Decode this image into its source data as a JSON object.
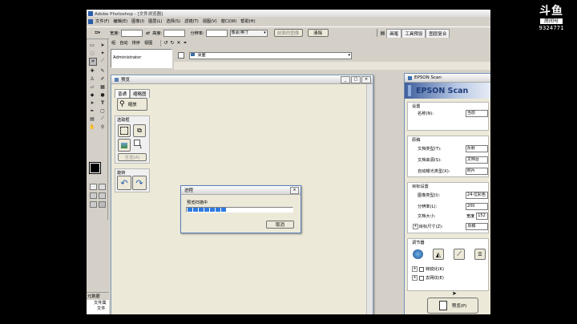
{
  "app": {
    "title": "Adobe Photoshop - [文件浏览器]"
  },
  "menu": [
    "文件(F)",
    "编辑(E)",
    "图像(I)",
    "图层(L)",
    "选择(S)",
    "滤镜(T)",
    "视图(V)",
    "窗口(W)",
    "帮助(H)"
  ],
  "options_bar": {
    "feather_label": "宽度:",
    "height_label": "高度:",
    "resolution_label": "分辨率:",
    "unit_value": "像素/英寸",
    "front_image_label": "前面的图像",
    "clear_label": "清除"
  },
  "palette_well": {
    "tabs": [
      "画笔",
      "工具预设",
      "图层复合"
    ]
  },
  "file_browser": {
    "menu": [
      "组",
      "自动",
      "排序",
      "视图"
    ],
    "folder_item": "Administrator",
    "location_value": "桌面"
  },
  "preview_window": {
    "title": "预览",
    "tabs": [
      "普通",
      "缩略图"
    ],
    "zoom_label": "缩放",
    "select_frame_label": "选取框",
    "select_all_label": "全选(A)",
    "rotate_label": "旋转",
    "count": "1"
  },
  "progress_dialog": {
    "title": "进程",
    "message": "预览扫描中",
    "cancel_label": "取消",
    "progress_blocks": 7
  },
  "epson": {
    "window_title": "EPSON Scan",
    "header": "EPSON Scan",
    "settings": {
      "section": "设置",
      "name_label": "名称(N):",
      "name_value": "当前"
    },
    "original": {
      "section": "原稿",
      "doc_type_label": "文档类型(T):",
      "doc_type_value": "反射",
      "doc_source_label": "文档来源(S):",
      "doc_source_value": "文档台",
      "auto_exposure_label": "自动曝光类型(X):",
      "auto_exposure_value": "照片"
    },
    "target": {
      "section": "目标设置",
      "image_type_label": "图像类型(I):",
      "image_type_value": "24-位彩色",
      "resolution_label": "分辨率(L):",
      "resolution_value": "200",
      "doc_size_label": "文档大小:",
      "width_label": "宽度",
      "width_value": "152",
      "target_size_label": "目标尺寸(Z):",
      "target_size_value": "原稿"
    },
    "adjust": {
      "section": "调节器",
      "unsharp_label": "钝锐化(K)",
      "descreen_label": "去网纹(E)"
    },
    "preview_label": "预览(P)"
  },
  "bottom_panel": {
    "tab": "元数据",
    "line1": "文件属",
    "line2": "文件"
  },
  "overlay": {
    "brand": "斗鱼",
    "sub": "房间号",
    "room_number": "9324771"
  }
}
